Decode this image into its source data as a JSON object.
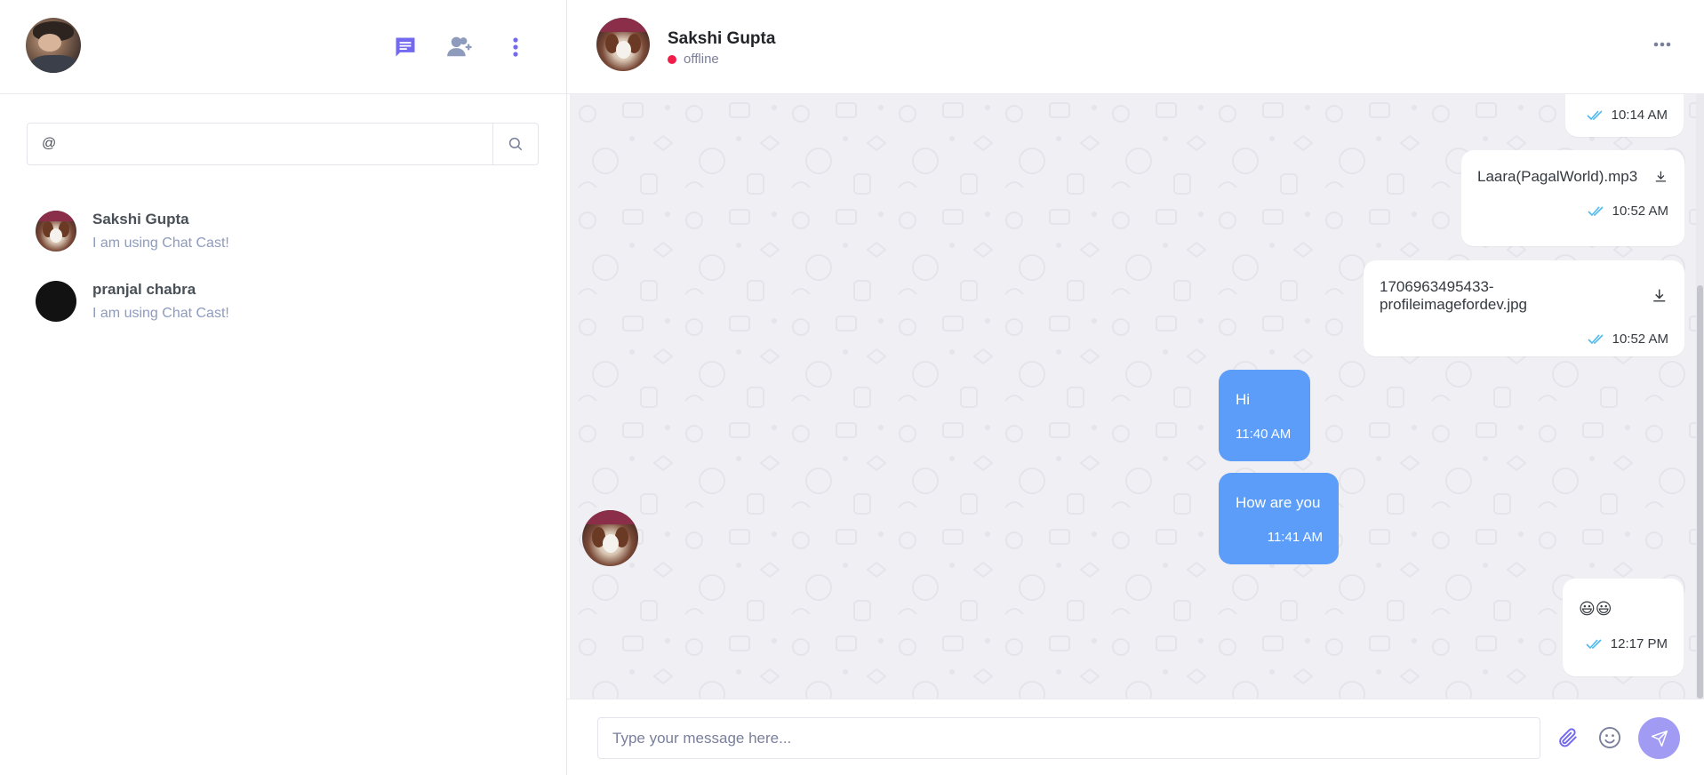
{
  "colors": {
    "accent": "#7269ef",
    "bubble_in": "#5b9df9",
    "bubble_out": "#ffffff",
    "offline_dot": "#ef1d48",
    "tick": "#4eb9f0",
    "send_button": "#a29bf4"
  },
  "sidebar": {
    "icons": [
      "chat-icon",
      "add-contact-icon",
      "more-vertical-icon"
    ],
    "search": {
      "value": "@",
      "icon": "search-icon"
    },
    "contacts": [
      {
        "name": "Sakshi Gupta",
        "status": "I am using Chat Cast!"
      },
      {
        "name": "pranjal chabra",
        "status": "I am using Chat Cast!"
      }
    ]
  },
  "chat": {
    "header": {
      "name": "Sakshi Gupta",
      "status": "offline"
    },
    "messages": [
      {
        "direction": "out",
        "type": "text",
        "text": "",
        "time": "10:14 AM",
        "read": true
      },
      {
        "direction": "out",
        "type": "file",
        "text": "Laara(PagalWorld).mp3",
        "time": "10:52 AM",
        "read": true
      },
      {
        "direction": "out",
        "type": "file",
        "text": "1706963495433-profileimagefordev.jpg",
        "time": "10:52 AM",
        "read": true
      },
      {
        "direction": "in",
        "type": "text",
        "text": "Hi",
        "time": "11:40 AM"
      },
      {
        "direction": "in",
        "type": "text",
        "text": "How are you",
        "time": "11:41 AM"
      },
      {
        "direction": "out",
        "type": "text",
        "text": "😃😃",
        "time": "12:17 PM",
        "read": true
      }
    ],
    "composer": {
      "placeholder": "Type your message here..."
    }
  }
}
